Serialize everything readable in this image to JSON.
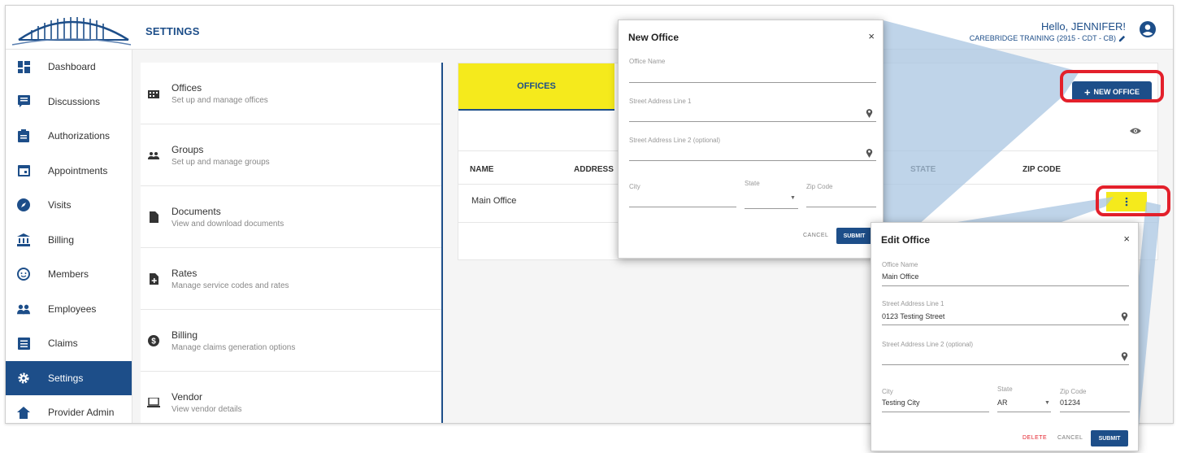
{
  "header": {
    "page_title": "SETTINGS",
    "greeting": "Hello, JENNIFER!",
    "agency": "CAREBRIDGE TRAINING (2915 - CDT - CB)"
  },
  "sidebar": {
    "items": [
      {
        "label": "Dashboard",
        "icon": "dashboard-icon"
      },
      {
        "label": "Discussions",
        "icon": "chat-icon"
      },
      {
        "label": "Authorizations",
        "icon": "clipboard-icon"
      },
      {
        "label": "Appointments",
        "icon": "calendar-icon"
      },
      {
        "label": "Visits",
        "icon": "compass-icon"
      },
      {
        "label": "Billing",
        "icon": "bank-icon"
      },
      {
        "label": "Members",
        "icon": "face-icon"
      },
      {
        "label": "Employees",
        "icon": "people-icon"
      },
      {
        "label": "Claims",
        "icon": "list-icon"
      },
      {
        "label": "Settings",
        "icon": "gear-icon",
        "active": true
      },
      {
        "label": "Provider Admin",
        "icon": "home-icon"
      }
    ]
  },
  "settings_menu": {
    "items": [
      {
        "title": "Offices",
        "subtitle": "Set up and manage offices",
        "icon": "building-icon"
      },
      {
        "title": "Groups",
        "subtitle": "Set up and manage groups",
        "icon": "group-icon"
      },
      {
        "title": "Documents",
        "subtitle": "View and download documents",
        "icon": "document-icon"
      },
      {
        "title": "Rates",
        "subtitle": "Manage service codes and rates",
        "icon": "rates-icon"
      },
      {
        "title": "Billing",
        "subtitle": "Manage claims generation options",
        "icon": "dollar-icon"
      },
      {
        "title": "Vendor",
        "subtitle": "View vendor details",
        "icon": "laptop-icon"
      }
    ]
  },
  "offices_panel": {
    "tab_label": "OFFICES",
    "new_office_label": "NEW OFFICE",
    "columns": {
      "name": "NAME",
      "address": "ADDRESS",
      "state": "STATE",
      "zip": "ZIP CODE"
    },
    "rows": [
      {
        "name": "Main Office"
      }
    ]
  },
  "new_office_dialog": {
    "title": "New Office",
    "office_name_label": "Office Name",
    "street1_label": "Street Address Line 1",
    "street2_label": "Street Address Line 2 (optional)",
    "city_label": "City",
    "state_label": "State",
    "zip_label": "Zip Code",
    "cancel_label": "CANCEL",
    "submit_label": "SUBMIT"
  },
  "edit_office_dialog": {
    "title": "Edit Office",
    "office_name_label": "Office Name",
    "office_name_value": "Main Office",
    "street1_label": "Street Address Line 1",
    "street1_value": "0123 Testing Street",
    "street2_label": "Street Address Line 2 (optional)",
    "city_label": "City",
    "city_value": "Testing City",
    "state_label": "State",
    "state_value": "AR",
    "zip_label": "Zip Code",
    "zip_value": "01234",
    "delete_label": "DELETE",
    "cancel_label": "CANCEL",
    "submit_label": "SUBMIT"
  },
  "colors": {
    "primary": "#1d4e89",
    "highlight_yellow": "#f5ea1c",
    "callout_red": "#e3202b",
    "callout_blue": "#a9c6e2"
  }
}
